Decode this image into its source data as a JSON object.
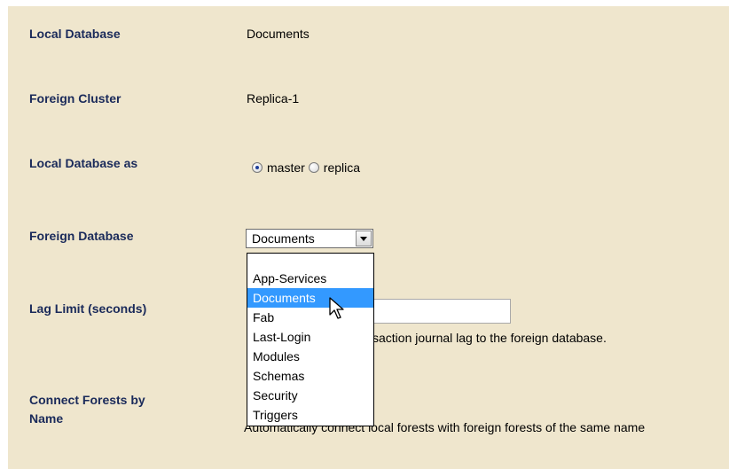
{
  "form": {
    "local_database": {
      "label": "Local Database",
      "value": "Documents"
    },
    "foreign_cluster": {
      "label": "Foreign Cluster",
      "value": "Replica-1"
    },
    "local_database_as": {
      "label": "Local Database as",
      "options": [
        "master",
        "replica"
      ],
      "selected": "master"
    },
    "foreign_database": {
      "label": "Foreign Database",
      "selected": "Documents",
      "options": [
        "App-Services",
        "Documents",
        "Fab",
        "Last-Login",
        "Modules",
        "Schemas",
        "Security",
        "Triggers"
      ]
    },
    "lag_limit": {
      "label": "Lag Limit (seconds)",
      "value": "",
      "help_visible": "saction journal lag to the foreign database."
    },
    "connect_forests": {
      "label_line1": "Connect Forests by",
      "label_line2": "Name",
      "help_visible": "Automatically connect local forests with foreign forests of the same name"
    }
  },
  "icons": {
    "dropdown_arrow": "chevron-down-icon",
    "cursor": "arrow-cursor-icon"
  },
  "colors": {
    "panel_bg": "#efe6cd",
    "label_color": "#1a2a5a",
    "selection_bg": "#3399ff"
  }
}
